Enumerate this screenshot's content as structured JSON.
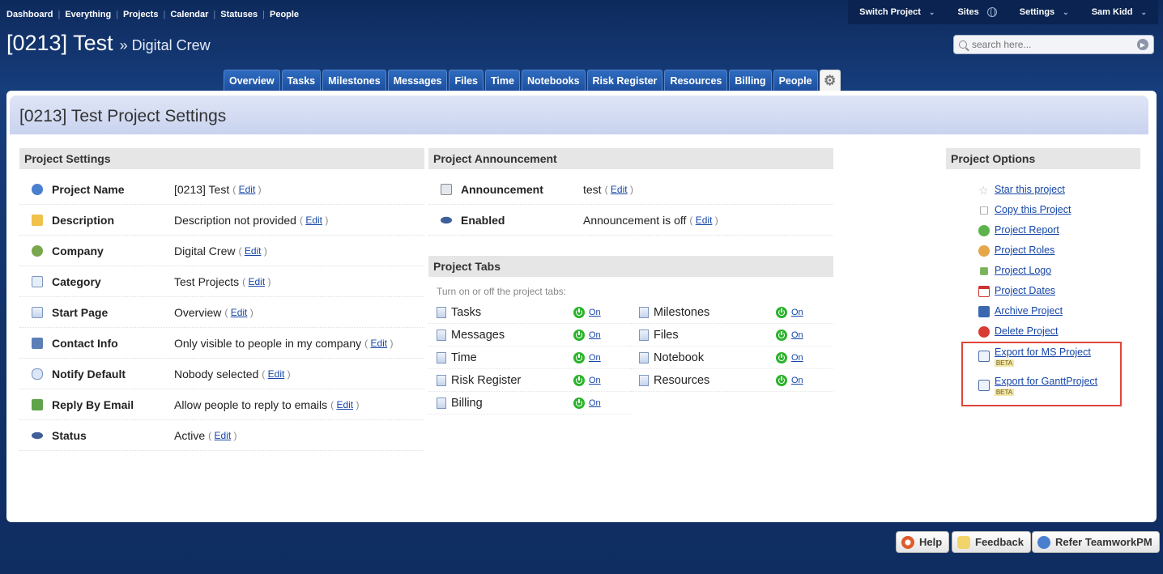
{
  "topnav": [
    "Dashboard",
    "Everything",
    "Projects",
    "Calendar",
    "Statuses",
    "People"
  ],
  "topright": {
    "switch_project": "Switch Project",
    "sites": "Sites",
    "settings": "Settings",
    "user": "Sam Kidd"
  },
  "header": {
    "title": "[0213] Test",
    "company": "» Digital Crew"
  },
  "search": {
    "placeholder": "search here..."
  },
  "tabs": [
    "Overview",
    "Tasks",
    "Milestones",
    "Messages",
    "Files",
    "Time",
    "Notebooks",
    "Risk Register",
    "Resources",
    "Billing",
    "People"
  ],
  "page_title": "[0213] Test Project Settings",
  "project_settings": {
    "heading": "Project Settings",
    "edit_label": "Edit",
    "rows": [
      {
        "label": "Project Name",
        "value": "[0213] Test",
        "icon": "info-icon"
      },
      {
        "label": "Description",
        "value": "Description not provided",
        "icon": "note-icon"
      },
      {
        "label": "Company",
        "value": "Digital Crew",
        "icon": "company-icon"
      },
      {
        "label": "Category",
        "value": "Test Projects",
        "icon": "folder-icon"
      },
      {
        "label": "Start Page",
        "value": "Overview",
        "icon": "page-icon"
      },
      {
        "label": "Contact Info",
        "value": "Only visible to people in my company",
        "icon": "contact-icon"
      },
      {
        "label": "Notify Default",
        "value": "Nobody selected",
        "icon": "speech-icon"
      },
      {
        "label": "Reply By Email",
        "value": "Allow people to reply to emails",
        "icon": "email-reply-icon"
      },
      {
        "label": "Status",
        "value": "Active",
        "icon": "eye-icon"
      }
    ]
  },
  "announcement": {
    "heading": "Project Announcement",
    "rows": [
      {
        "label": "Announcement",
        "value": "test"
      },
      {
        "label": "Enabled",
        "value": "Announcement is off"
      }
    ]
  },
  "project_tabs": {
    "heading": "Project Tabs",
    "hint": "Turn on or off the project tabs:",
    "on_label": "On",
    "left": [
      "Tasks",
      "Messages",
      "Time",
      "Risk Register",
      "Billing"
    ],
    "right": [
      "Milestones",
      "Files",
      "Notebook",
      "Resources"
    ]
  },
  "options": {
    "heading": "Project Options",
    "items": [
      "Star this project",
      "Copy this Project",
      "Project Report",
      "Project Roles",
      "Project Logo",
      "Project Dates",
      "Archive Project",
      "Delete Project"
    ],
    "export_ms": "Export for MS Project",
    "export_gantt": "Export for GanttProject",
    "beta": "BETA"
  },
  "footer": {
    "help": "Help",
    "feedback": "Feedback",
    "refer": "Refer TeamworkPM"
  }
}
